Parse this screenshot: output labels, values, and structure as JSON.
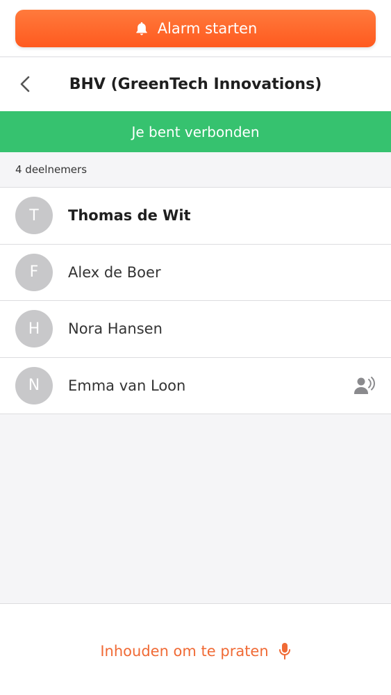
{
  "alarm": {
    "label": "Alarm starten",
    "icon": "bell-icon"
  },
  "header": {
    "title": "BHV (GreenTech Innovations)",
    "back_icon": "chevron-left-icon"
  },
  "banner": {
    "text": "Je bent verbonden",
    "color": "#36c26f"
  },
  "participants": {
    "count_label": "4 deelnemers",
    "items": [
      {
        "initial": "T",
        "name": "Thomas de Wit",
        "bold": true,
        "speaking": false
      },
      {
        "initial": "F",
        "name": "Alex de Boer",
        "bold": false,
        "speaking": false
      },
      {
        "initial": "H",
        "name": "Nora Hansen",
        "bold": false,
        "speaking": false
      },
      {
        "initial": "N",
        "name": "Emma van Loon",
        "bold": false,
        "speaking": true
      }
    ]
  },
  "push_to_talk": {
    "label": "Inhouden om te praten",
    "icon": "microphone-icon",
    "color": "#f06a35"
  },
  "colors": {
    "alarm": "#ff5a1f",
    "avatar": "#c8c8ca"
  }
}
